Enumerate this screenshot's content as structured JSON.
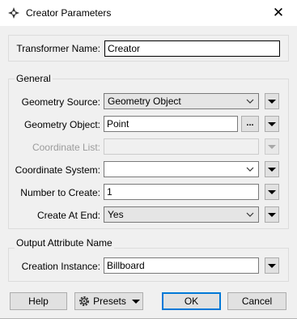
{
  "window": {
    "title": "Creator Parameters",
    "close_glyph": "✕"
  },
  "transformer": {
    "label": "Transformer Name:",
    "value": "Creator"
  },
  "general": {
    "title": "General",
    "geometry_source": {
      "label": "Geometry Source:",
      "value": "Geometry Object"
    },
    "geometry_object": {
      "label": "Geometry Object:",
      "value": "Point",
      "browse": "..."
    },
    "coordinate_list": {
      "label": "Coordinate List:",
      "value": ""
    },
    "coordinate_system": {
      "label": "Coordinate System:",
      "value": ""
    },
    "number_to_create": {
      "label": "Number to Create:",
      "value": "1"
    },
    "create_at_end": {
      "label": "Create At End:",
      "value": "Yes"
    }
  },
  "output": {
    "title": "Output Attribute Name",
    "creation_instance": {
      "label": "Creation Instance:",
      "value": "Billboard"
    }
  },
  "buttons": {
    "help": "Help",
    "presets": "Presets",
    "ok": "OK",
    "cancel": "Cancel"
  },
  "icons": {
    "app": "fme-transformer-icon",
    "presets": "gear-icon",
    "menu": "triangle-down-icon",
    "combo": "chevron-down-icon"
  }
}
